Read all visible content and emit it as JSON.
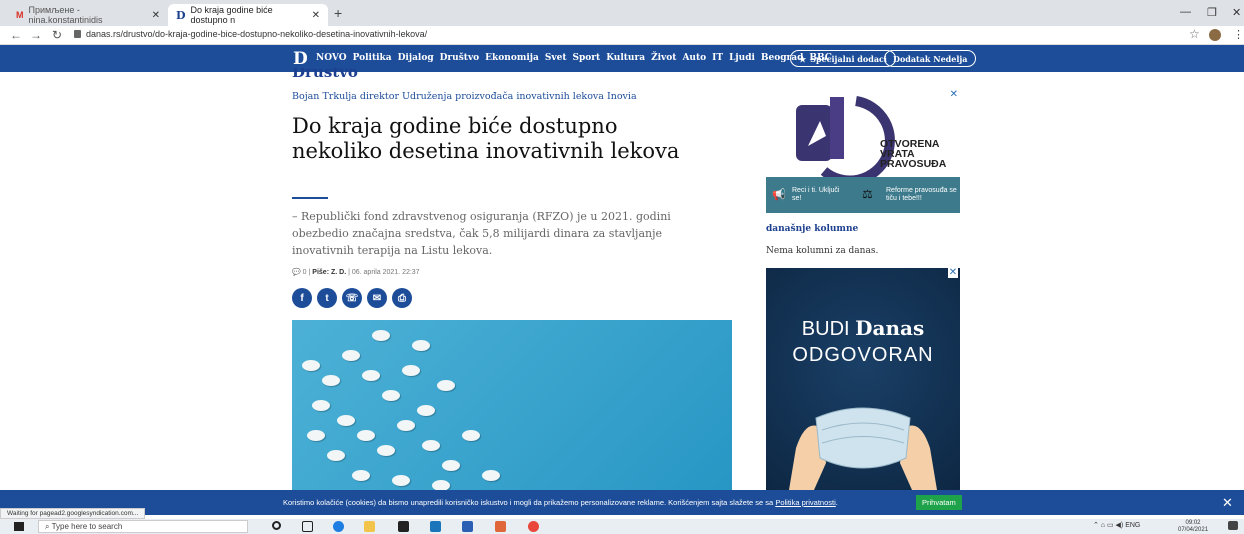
{
  "browser": {
    "tabs": [
      {
        "label": "Примљене - nina.konstantinidis"
      },
      {
        "label": "Do kraja godine biće dostupno n"
      }
    ],
    "url": "danas.rs/drustvo/do-kraja-godine-bice-dostupno-nekoliko-desetina-inovativnih-lekova/",
    "status": "Waiting for pagead2.googlesyndication.com..."
  },
  "site": {
    "logo": "D",
    "menu": [
      "NOVO",
      "Politika",
      "Dijalog",
      "Društvo",
      "Ekonomija",
      "Svet",
      "Sport",
      "Kultura",
      "Život",
      "Auto",
      "IT",
      "Ljudi",
      "Beograd",
      "BBC"
    ],
    "special": "Specijalni dodaci",
    "supplement": "Dodatak Nedelja"
  },
  "article": {
    "section": "Društvo",
    "subtitle": "Bojan Trkulja direktor Udruženja proizvođača inovativnih lekova Inovia",
    "headline": "Do kraja godine biće dostupno nekoliko desetina inovativnih lekova",
    "lead": "– Republički fond zdravstvenog osiguranja (RFZO) je u 2021. godini obezbedio značajna sredstva, čak 5,8 milijardi dinara za stavljanje inovativnih terapija na Listu lekova.",
    "comments": "0",
    "author": "Piše: Z. D.",
    "date": "06. aprila 2021. 22:37"
  },
  "sidebar": {
    "ad1": {
      "brand": "OTVORENA VRATA PRAVOSUĐA",
      "left_text": "Reci i ti. Uključi se!",
      "right_text": "Reforme pravosuđa se tiču i tebe!!!"
    },
    "columns_title": "današnje kolumne",
    "columns_empty": "Nema kolumni za danas.",
    "ad2": {
      "line1a": "BUDI",
      "line1b": "Danas",
      "line2": "ODGOVORAN"
    }
  },
  "cookie": {
    "text": "Koristimo kolačiće (cookies) da bismo unapredili korisničko iskustvo i mogli da prikažemo personalizovane reklame. Korišćenjem sajta slažete se sa",
    "link": "Politika privatnosti",
    "accept": "Prihvatam"
  },
  "taskbar": {
    "search": "Type here to search",
    "lang": "ENG",
    "time": "09:02",
    "date": "07/04/2021"
  },
  "colors": {
    "brand_blue": "#1d4d99",
    "accept_green": "#1fa34a"
  }
}
